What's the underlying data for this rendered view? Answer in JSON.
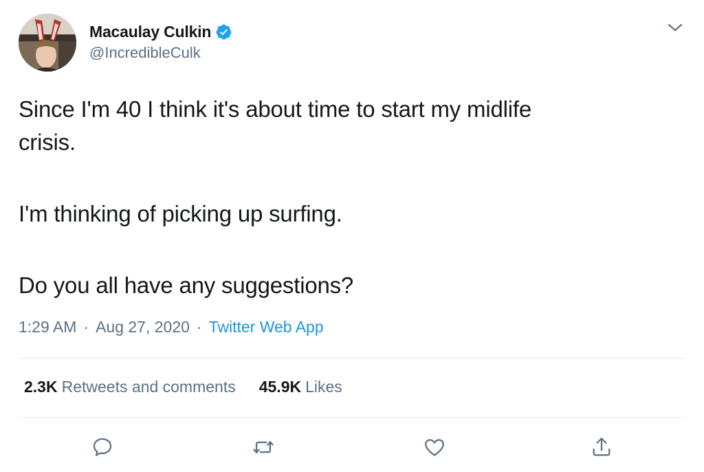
{
  "tweet": {
    "author": {
      "display_name": "Macaulay Culkin",
      "handle": "@IncredibleCulk",
      "verified": true,
      "avatar_icon": "avatar-photo"
    },
    "body_lines": [
      "Since I'm 40 I think it's about time to start my midlife",
      "crisis.",
      "I'm thinking of picking up surfing.",
      "Do you all have any suggestions?"
    ],
    "time": "1:29 AM",
    "date": "Aug 27, 2020",
    "separator": "·",
    "source": "Twitter Web App",
    "stats": {
      "retweets_count": "2.3K",
      "retweets_label": "Retweets and comments",
      "likes_count": "45.9K",
      "likes_label": "Likes"
    },
    "actions": [
      "reply-icon",
      "retweet-icon",
      "like-icon",
      "share-icon"
    ],
    "menu_icon": "chevron-down-icon",
    "colors": {
      "text": "#14171a",
      "secondary": "#5b7083",
      "link": "#1b95e0",
      "verified": "#1da1f2",
      "divider": "#e1e8ed"
    }
  }
}
